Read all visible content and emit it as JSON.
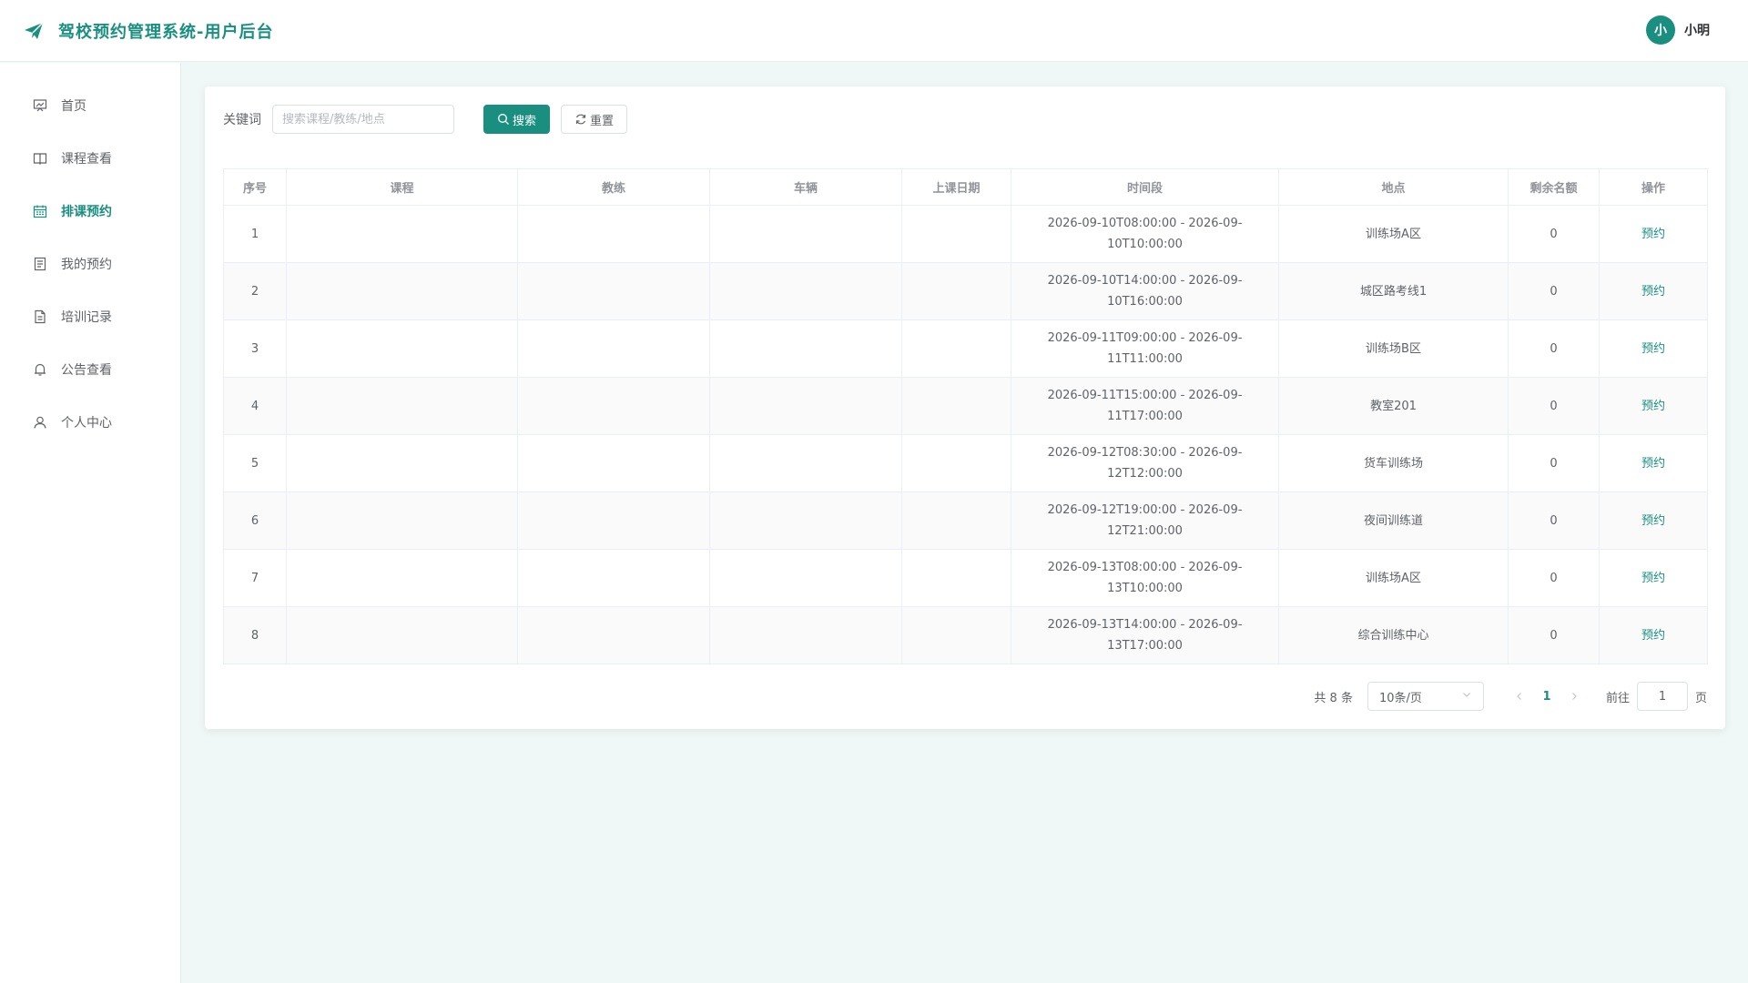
{
  "header": {
    "title": "驾校预约管理系统-用户后台",
    "avatar_char": "小",
    "username": "小明"
  },
  "sidebar": {
    "items": [
      {
        "label": "首页",
        "icon": "presentation-icon"
      },
      {
        "label": "课程查看",
        "icon": "book-icon"
      },
      {
        "label": "排课预约",
        "icon": "calendar-icon",
        "active": true
      },
      {
        "label": "我的预约",
        "icon": "document-icon"
      },
      {
        "label": "培训记录",
        "icon": "file-icon"
      },
      {
        "label": "公告查看",
        "icon": "bell-icon"
      },
      {
        "label": "个人中心",
        "icon": "user-icon"
      }
    ]
  },
  "search": {
    "label": "关键词",
    "placeholder": "搜索课程/教练/地点",
    "value": "",
    "search_button": "搜索",
    "reset_button": "重置"
  },
  "table": {
    "columns": [
      "序号",
      "课程",
      "教练",
      "车辆",
      "上课日期",
      "时间段",
      "地点",
      "剩余名额",
      "操作"
    ],
    "rows": [
      {
        "no": "1",
        "course": "",
        "coach": "",
        "vehicle": "",
        "date": "",
        "time_line1": "2026-09-10T08:00:00 - 2026-09-",
        "time_line2": "10T10:00:00",
        "location": "训练场A区",
        "remaining": "0",
        "action": "预约"
      },
      {
        "no": "2",
        "course": "",
        "coach": "",
        "vehicle": "",
        "date": "",
        "time_line1": "2026-09-10T14:00:00 - 2026-09-",
        "time_line2": "10T16:00:00",
        "location": "城区路考线1",
        "remaining": "0",
        "action": "预约"
      },
      {
        "no": "3",
        "course": "",
        "coach": "",
        "vehicle": "",
        "date": "",
        "time_line1": "2026-09-11T09:00:00 - 2026-09-",
        "time_line2": "11T11:00:00",
        "location": "训练场B区",
        "remaining": "0",
        "action": "预约"
      },
      {
        "no": "4",
        "course": "",
        "coach": "",
        "vehicle": "",
        "date": "",
        "time_line1": "2026-09-11T15:00:00 - 2026-09-",
        "time_line2": "11T17:00:00",
        "location": "教室201",
        "remaining": "0",
        "action": "预约"
      },
      {
        "no": "5",
        "course": "",
        "coach": "",
        "vehicle": "",
        "date": "",
        "time_line1": "2026-09-12T08:30:00 - 2026-09-",
        "time_line2": "12T12:00:00",
        "location": "货车训练场",
        "remaining": "0",
        "action": "预约"
      },
      {
        "no": "6",
        "course": "",
        "coach": "",
        "vehicle": "",
        "date": "",
        "time_line1": "2026-09-12T19:00:00 - 2026-09-",
        "time_line2": "12T21:00:00",
        "location": "夜间训练道",
        "remaining": "0",
        "action": "预约"
      },
      {
        "no": "7",
        "course": "",
        "coach": "",
        "vehicle": "",
        "date": "",
        "time_line1": "2026-09-13T08:00:00 - 2026-09-",
        "time_line2": "13T10:00:00",
        "location": "训练场A区",
        "remaining": "0",
        "action": "预约"
      },
      {
        "no": "8",
        "course": "",
        "coach": "",
        "vehicle": "",
        "date": "",
        "time_line1": "2026-09-13T14:00:00 - 2026-09-",
        "time_line2": "13T17:00:00",
        "location": "综合训练中心",
        "remaining": "0",
        "action": "预约"
      }
    ]
  },
  "pagination": {
    "total_text": "共 8 条",
    "page_size": "10条/页",
    "current_page": "1",
    "goto_label": "前往",
    "goto_value": "1",
    "page_suffix": "页"
  },
  "colors": {
    "accent": "#1a8f80",
    "background": "#f0f8f7"
  }
}
